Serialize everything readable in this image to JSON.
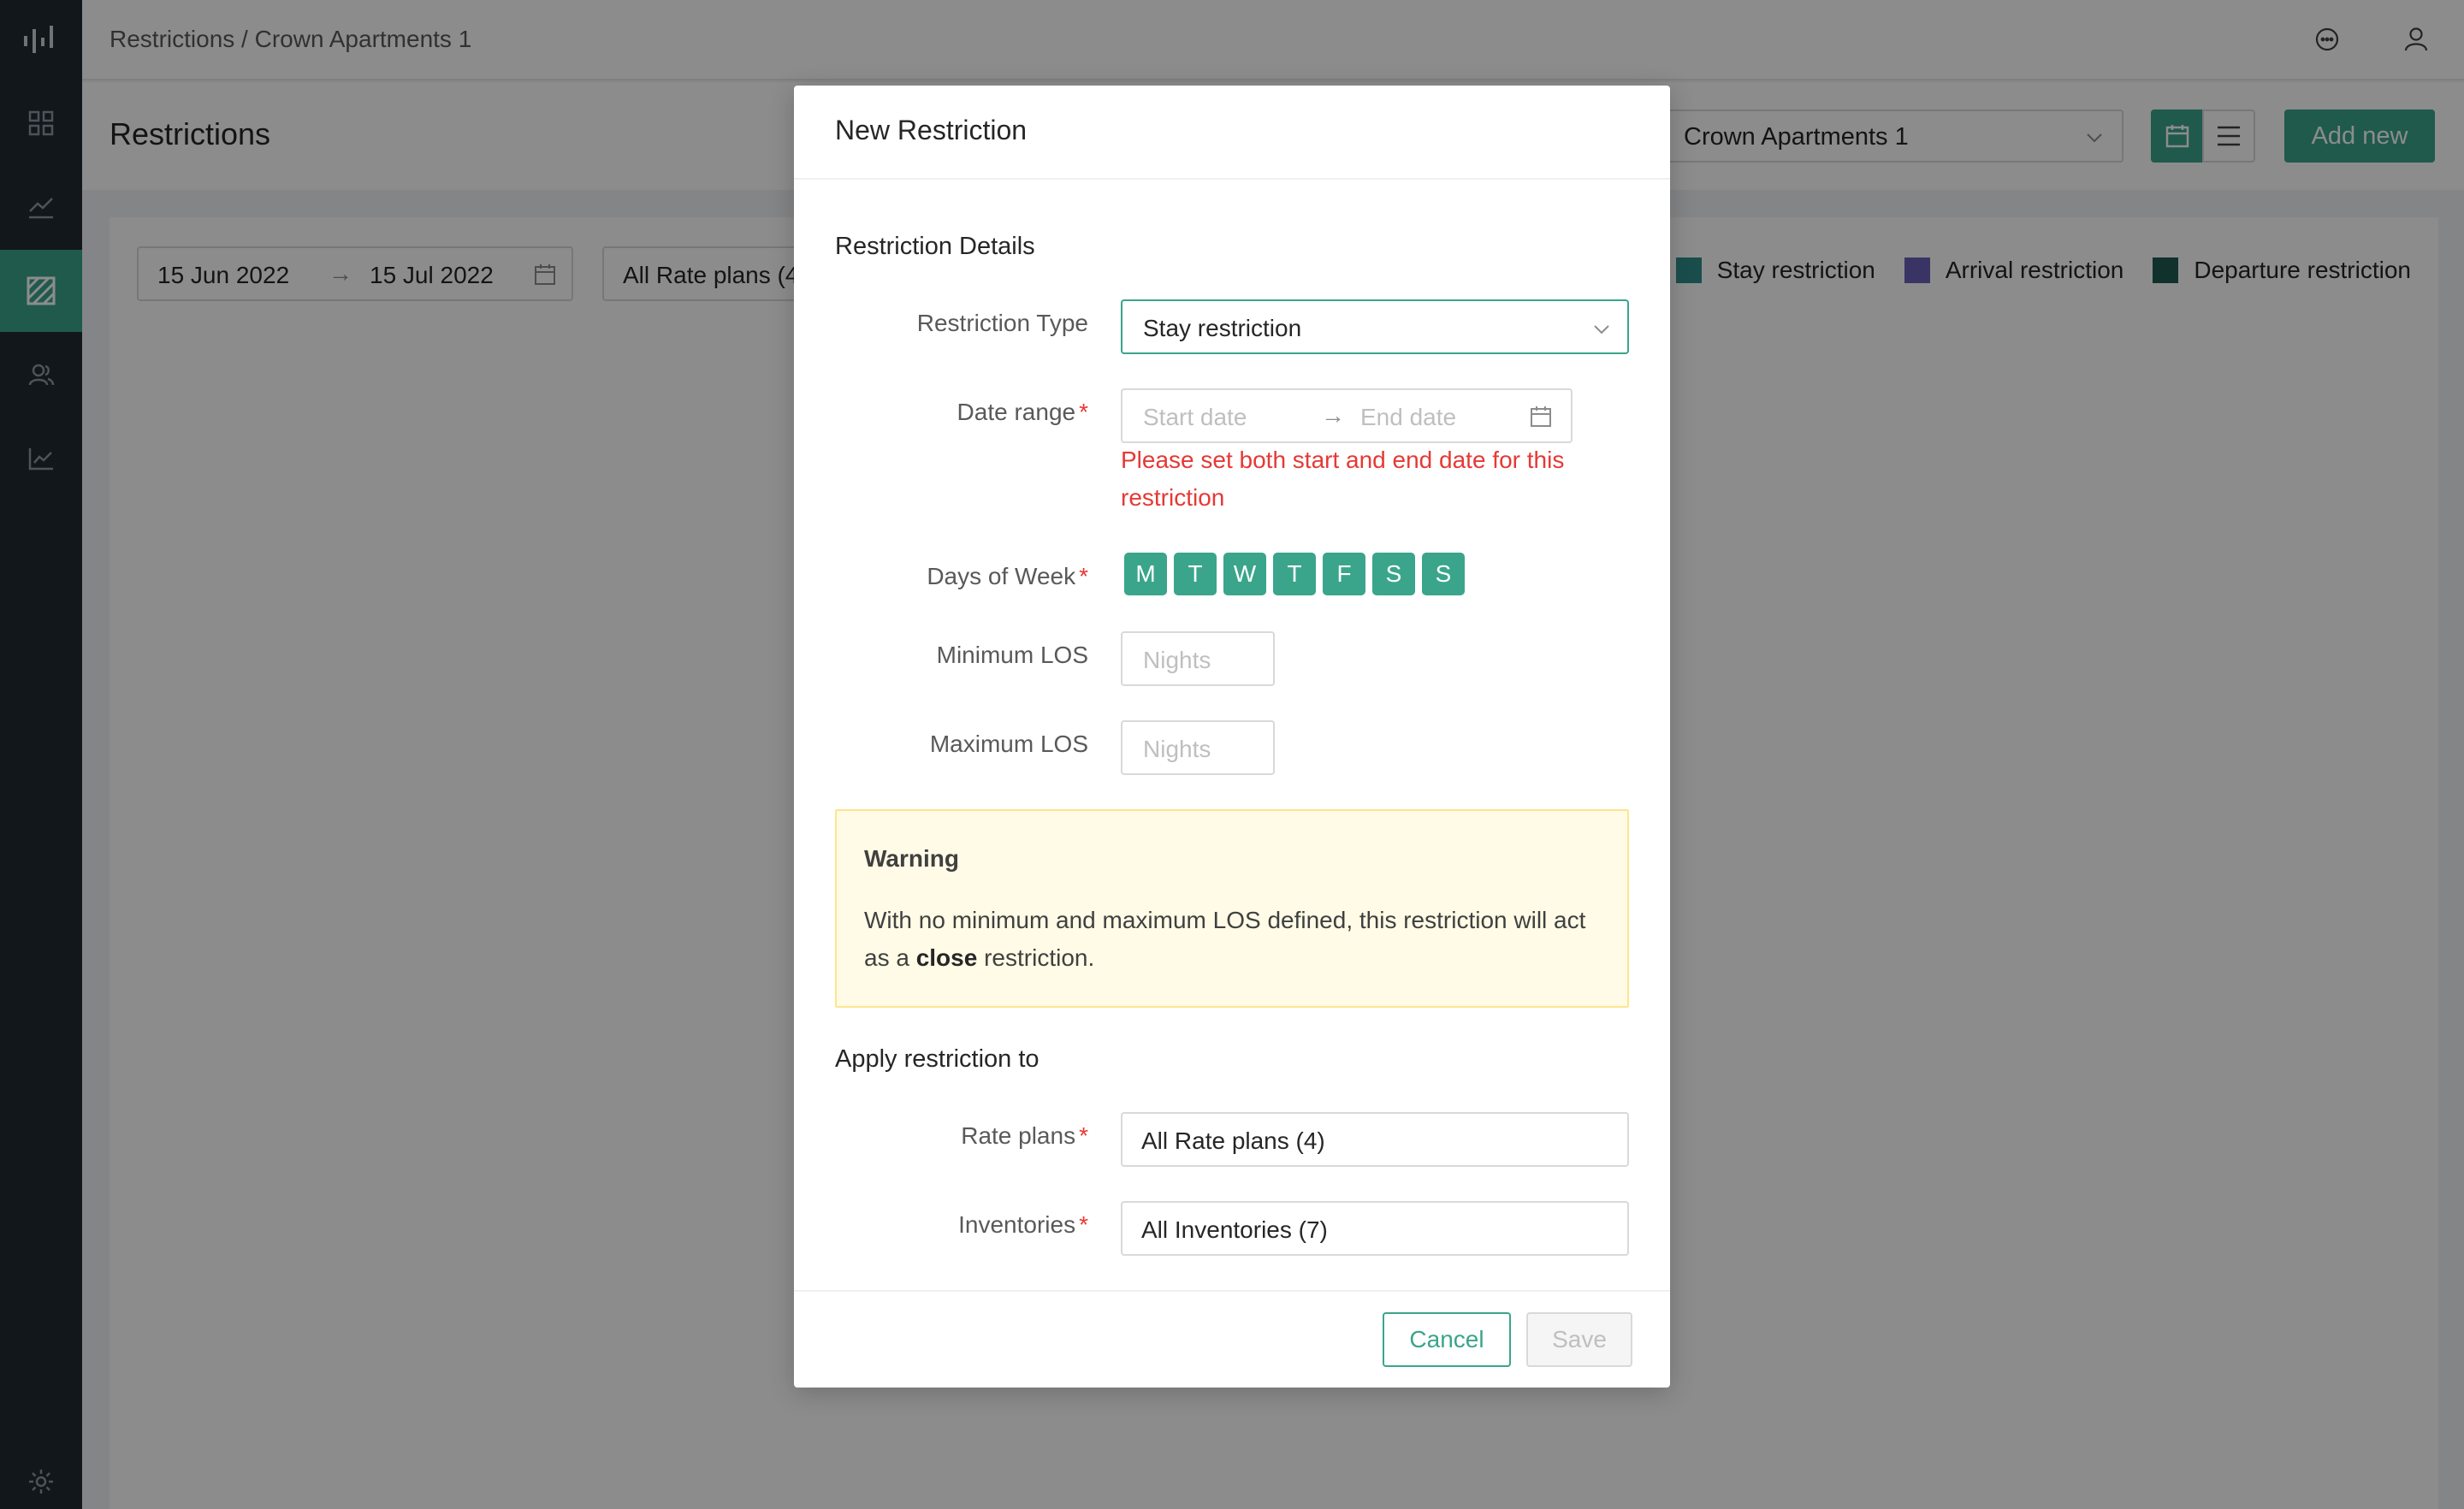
{
  "breadcrumb": "Restrictions / Crown Apartments 1",
  "sidebar": {
    "items": [
      {
        "icon": "dashboard-icon"
      },
      {
        "icon": "analytics-icon"
      },
      {
        "icon": "restrictions-icon",
        "active": true
      },
      {
        "icon": "users-icon"
      },
      {
        "icon": "reports-icon"
      },
      {
        "icon": "settings-icon"
      }
    ]
  },
  "header": {
    "title": "Restrictions",
    "property": "Crown Apartments 1",
    "add_label": "Add new"
  },
  "filters": {
    "start_date": "15 Jun 2022",
    "end_date": "15 Jul 2022",
    "rate_plans": "All Rate plans (4)"
  },
  "legend": [
    {
      "label": "Stay restriction",
      "color": "#2e8f8a"
    },
    {
      "label": "Arrival restriction",
      "color": "#6a60b8"
    },
    {
      "label": "Departure restriction",
      "color": "#1f5a52"
    }
  ],
  "modal": {
    "title": "New Restriction",
    "details_title": "Restriction Details",
    "restriction_type_label": "Restriction Type",
    "restriction_type_value": "Stay restriction",
    "date_range_label": "Date range",
    "start_placeholder": "Start date",
    "end_placeholder": "End date",
    "date_error": "Please set both start and end date for this restriction",
    "days_label": "Days of Week",
    "days": [
      "M",
      "T",
      "W",
      "T",
      "F",
      "S",
      "S"
    ],
    "min_los_label": "Minimum LOS",
    "max_los_label": "Maximum LOS",
    "nights_placeholder": "Nights",
    "warning_title": "Warning",
    "warning_pre": "With no minimum and maximum LOS defined, this restriction will act as a ",
    "warning_bold": "close",
    "warning_post": " restriction.",
    "apply_title": "Apply restriction to",
    "rate_plans_label": "Rate plans",
    "rate_plans_value": "All Rate plans (4)",
    "inventories_label": "Inventories",
    "inventories_value": "All Inventories (7)",
    "cancel_label": "Cancel",
    "save_label": "Save"
  },
  "colors": {
    "accent": "#3aa58a",
    "sidebar": "#1f2a30",
    "error": "#e53935",
    "warning_bg": "#fffbe6"
  }
}
